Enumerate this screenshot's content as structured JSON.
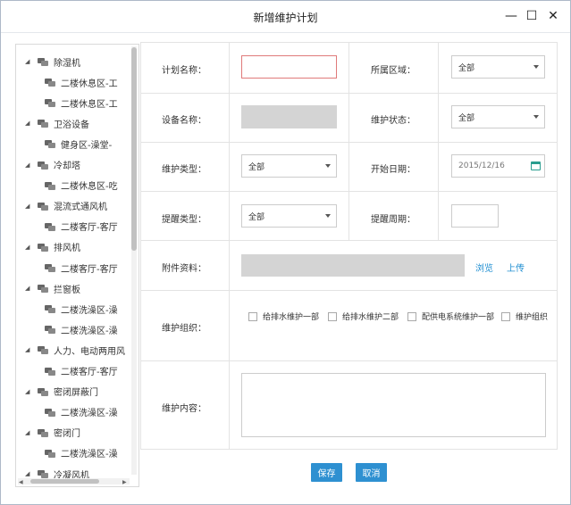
{
  "window": {
    "title": "新增维护计划",
    "minimize_glyph": "—",
    "maximize_glyph": "☐",
    "close_glyph": "✕"
  },
  "tree": {
    "items": [
      {
        "label": "除湿机",
        "level": 0
      },
      {
        "label": "二楼休息区-工",
        "level": 1
      },
      {
        "label": "二楼休息区-工",
        "level": 1
      },
      {
        "label": "卫浴设备",
        "level": 0
      },
      {
        "label": "健身区-澡堂-",
        "level": 1
      },
      {
        "label": "冷却塔",
        "level": 0
      },
      {
        "label": "二楼休息区-吃",
        "level": 1
      },
      {
        "label": "混流式通风机",
        "level": 0
      },
      {
        "label": "二楼客厅-客厅",
        "level": 1
      },
      {
        "label": "排风机",
        "level": 0
      },
      {
        "label": "二楼客厅-客厅",
        "level": 1
      },
      {
        "label": "拦窗板",
        "level": 0
      },
      {
        "label": "二楼洗澡区-澡",
        "level": 1
      },
      {
        "label": "二楼洗澡区-澡",
        "level": 1
      },
      {
        "label": "人力、电动两用风",
        "level": 0
      },
      {
        "label": "二楼客厅-客厅",
        "level": 1
      },
      {
        "label": "密闭屏蔽门",
        "level": 0
      },
      {
        "label": "二楼洗澡区-澡",
        "level": 1
      },
      {
        "label": "密闭门",
        "level": 0
      },
      {
        "label": "二楼洗澡区-澡",
        "level": 1
      },
      {
        "label": "冷凝风机",
        "level": 0
      }
    ]
  },
  "form": {
    "plan_name_label": "计划名称：",
    "plan_name_value": "",
    "area_label": "所属区域：",
    "area_value": "全部",
    "device_name_label": "设备名称：",
    "device_name_value": "",
    "status_label": "维护状态：",
    "status_value": "全部",
    "type_label": "维护类型：",
    "type_value": "全部",
    "start_date_label": "开始日期：",
    "start_date_value": "2015/12/16",
    "reminder_type_label": "提醒类型：",
    "reminder_type_value": "全部",
    "reminder_cycle_label": "提醒周期：",
    "reminder_cycle_value": "",
    "attachment_label": "附件资料：",
    "browse_label": "浏览",
    "upload_label": "上传",
    "org_label": "维护组织：",
    "orgs": [
      "给排水维护一部",
      "给排水维护二部",
      "配供电系统维护一部",
      "维护组织"
    ],
    "content_label": "维护内容：",
    "content_value": ""
  },
  "actions": {
    "save_label": "保存",
    "cancel_label": "取消"
  },
  "colors": {
    "primary_button": "#2e90d1",
    "link": "#1f8ed1",
    "error_border": "#e07a7a"
  }
}
